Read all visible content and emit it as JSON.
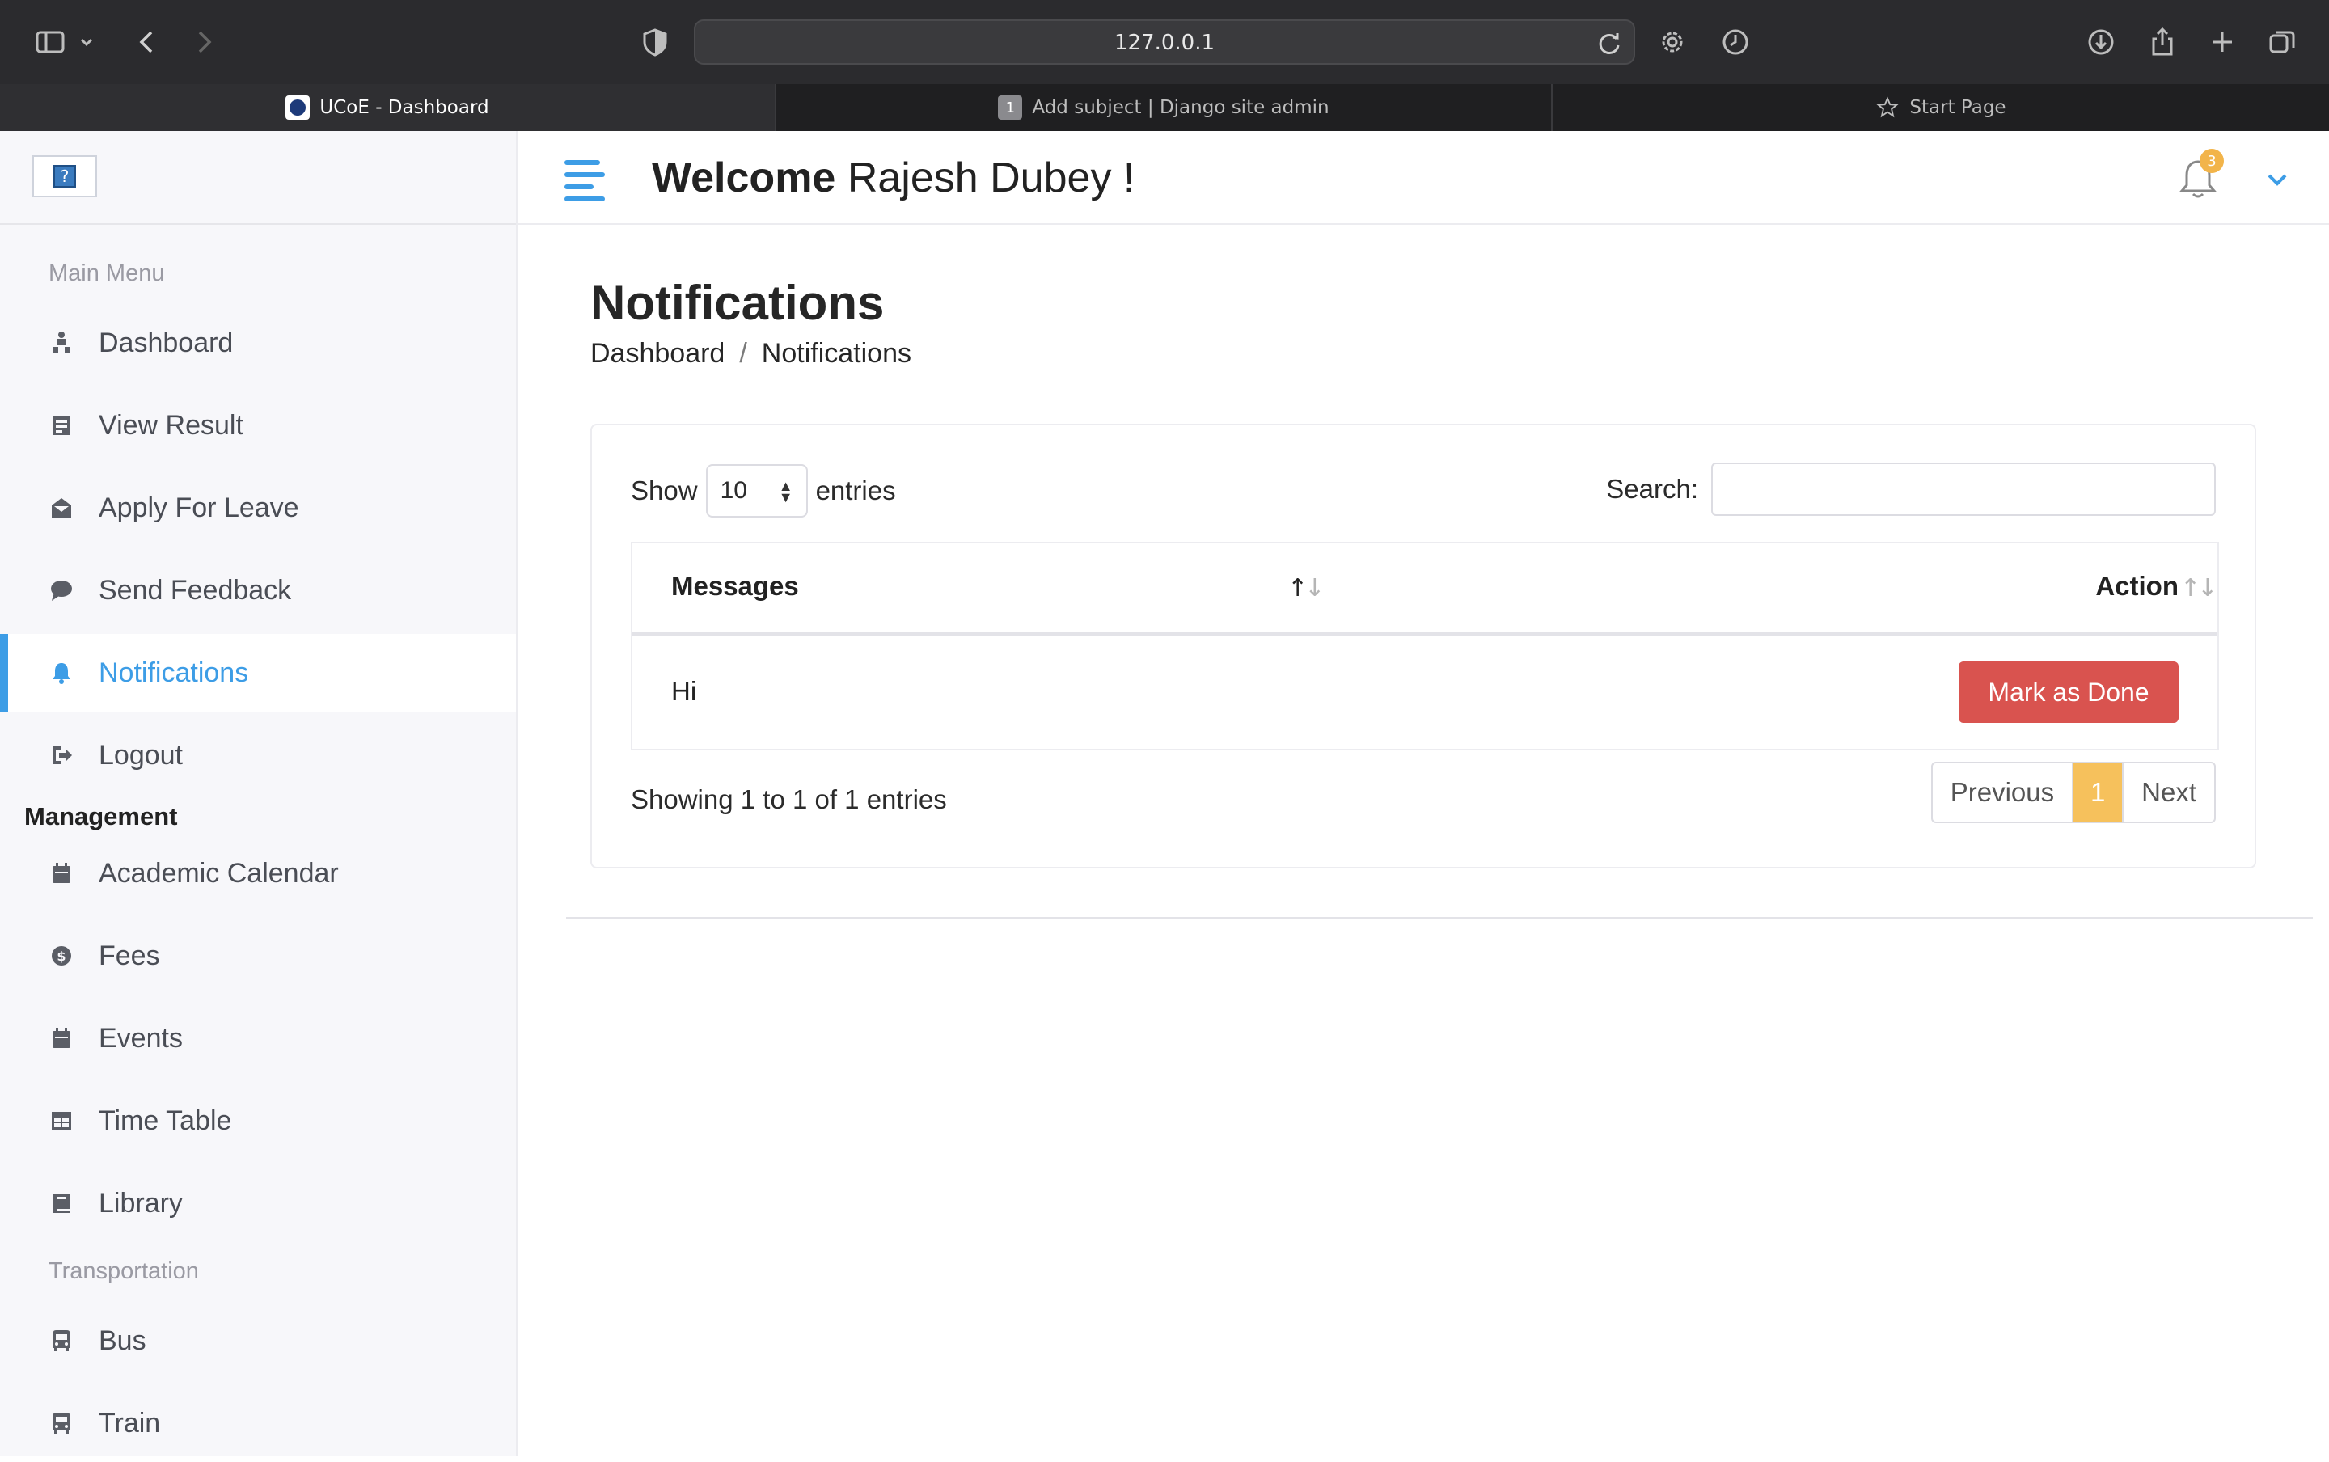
{
  "browser": {
    "url": "127.0.0.1",
    "tabs": [
      {
        "label": "UCoE - Dashboard",
        "active": true
      },
      {
        "label": "Add subject | Django site admin",
        "badge": "1",
        "active": false
      },
      {
        "label": "Start Page",
        "active": false
      }
    ],
    "icons": [
      "sidebar-toggle-icon",
      "chevron-down-icon",
      "back-icon",
      "forward-icon",
      "shield-icon",
      "reload-icon",
      "settings-icon",
      "history-icon",
      "download-icon",
      "share-icon",
      "new-tab-icon",
      "tab-overview-icon"
    ]
  },
  "sidebar": {
    "main_menu_title": "Main Menu",
    "main_items": [
      {
        "label": "Dashboard",
        "icon": "dashboard-icon"
      },
      {
        "label": "View Result",
        "icon": "result-icon"
      },
      {
        "label": "Apply For Leave",
        "icon": "envelope-icon"
      },
      {
        "label": "Send Feedback",
        "icon": "comment-icon"
      },
      {
        "label": "Notifications",
        "icon": "bell-icon",
        "active": true
      },
      {
        "label": "Logout",
        "icon": "logout-icon"
      }
    ],
    "management_title": "Management",
    "management_items": [
      {
        "label": "Academic Calendar",
        "icon": "calendar-icon"
      },
      {
        "label": "Fees",
        "icon": "money-icon"
      },
      {
        "label": "Events",
        "icon": "calendar-icon"
      },
      {
        "label": "Time Table",
        "icon": "table-icon"
      },
      {
        "label": "Library",
        "icon": "book-icon"
      }
    ],
    "transport_title": "Transportation",
    "transport_items": [
      {
        "label": "Bus",
        "icon": "bus-icon"
      },
      {
        "label": "Train",
        "icon": "train-icon"
      }
    ]
  },
  "header": {
    "welcome_prefix": "Welcome",
    "user_name": "Rajesh Dubey",
    "welcome_suffix": " !",
    "notification_count": "3"
  },
  "page": {
    "title": "Notifications",
    "breadcrumb": [
      "Dashboard",
      "Notifications"
    ],
    "breadcrumb_sep": "/"
  },
  "table": {
    "show_label": "Show",
    "entries_label": "entries",
    "page_length": "10",
    "search_label": "Search:",
    "search_value": "",
    "columns": [
      "Messages",
      "Action"
    ],
    "rows": [
      {
        "message": "Hi",
        "action": "Mark as Done"
      }
    ],
    "info": "Showing 1 to 1 of 1 entries",
    "pagination": {
      "previous": "Previous",
      "current": "1",
      "next": "Next"
    }
  },
  "colors": {
    "accent": "#3d9de6",
    "danger": "#d9534f",
    "pager_active": "#f6c15c",
    "badge": "#f2b44a"
  }
}
